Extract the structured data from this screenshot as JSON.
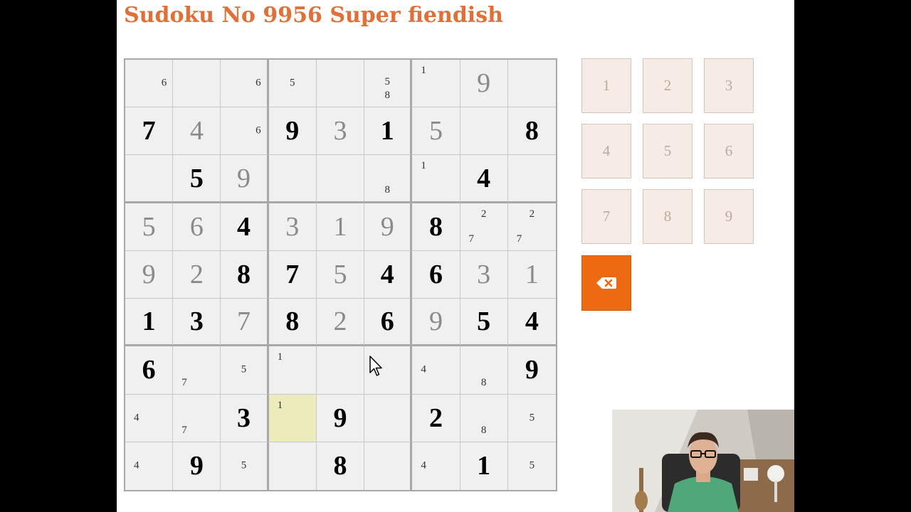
{
  "title": "Sudoku No 9956 Super fiendish",
  "board": [
    [
      {
        "pm": [
          {
            "t": "6",
            "pos": "mid right"
          }
        ]
      },
      {},
      {
        "pm": [
          {
            "t": "6",
            "pos": "mid right"
          }
        ]
      },
      {
        "pm": [
          {
            "t": "5",
            "pos": "mid center"
          }
        ]
      },
      {},
      {
        "pm": [
          {
            "t": "5",
            "pos": "top2 center"
          },
          {
            "t": "8",
            "pos": "bot center"
          }
        ]
      },
      {
        "pm": [
          {
            "t": "1",
            "pos": "top left"
          }
        ]
      },
      {
        "v": "9",
        "k": "user"
      },
      {}
    ],
    [
      {
        "v": "7",
        "k": "given"
      },
      {
        "v": "4",
        "k": "user"
      },
      {
        "pm": [
          {
            "t": "6",
            "pos": "mid right"
          }
        ]
      },
      {
        "v": "9",
        "k": "given"
      },
      {
        "v": "3",
        "k": "user"
      },
      {
        "v": "1",
        "k": "given"
      },
      {
        "v": "5",
        "k": "user"
      },
      {},
      {
        "v": "8",
        "k": "given"
      }
    ],
    [
      {},
      {
        "v": "5",
        "k": "given"
      },
      {
        "v": "9",
        "k": "user"
      },
      {},
      {},
      {
        "pm": [
          {
            "t": "8",
            "pos": "bot center"
          }
        ]
      },
      {
        "pm": [
          {
            "t": "1",
            "pos": "top left"
          }
        ]
      },
      {
        "v": "4",
        "k": "given"
      },
      {}
    ],
    [
      {
        "v": "5",
        "k": "user"
      },
      {
        "v": "6",
        "k": "user"
      },
      {
        "v": "4",
        "k": "given"
      },
      {
        "v": "3",
        "k": "user"
      },
      {
        "v": "1",
        "k": "user"
      },
      {
        "v": "9",
        "k": "user"
      },
      {
        "v": "8",
        "k": "given"
      },
      {
        "pm": [
          {
            "t": "2",
            "pos": "top center"
          },
          {
            "t": "7",
            "pos": "bot left"
          }
        ]
      },
      {
        "pm": [
          {
            "t": "2",
            "pos": "top center"
          },
          {
            "t": "7",
            "pos": "bot left"
          }
        ]
      }
    ],
    [
      {
        "v": "9",
        "k": "user"
      },
      {
        "v": "2",
        "k": "user"
      },
      {
        "v": "8",
        "k": "given"
      },
      {
        "v": "7",
        "k": "given"
      },
      {
        "v": "5",
        "k": "user"
      },
      {
        "v": "4",
        "k": "given"
      },
      {
        "v": "6",
        "k": "given"
      },
      {
        "v": "3",
        "k": "user"
      },
      {
        "v": "1",
        "k": "user"
      }
    ],
    [
      {
        "v": "1",
        "k": "given"
      },
      {
        "v": "3",
        "k": "given"
      },
      {
        "v": "7",
        "k": "user"
      },
      {
        "v": "8",
        "k": "given"
      },
      {
        "v": "2",
        "k": "user"
      },
      {
        "v": "6",
        "k": "given"
      },
      {
        "v": "9",
        "k": "user"
      },
      {
        "v": "5",
        "k": "given"
      },
      {
        "v": "4",
        "k": "given"
      }
    ],
    [
      {
        "v": "6",
        "k": "given"
      },
      {
        "pm": [
          {
            "t": "7",
            "pos": "bot left"
          }
        ]
      },
      {
        "pm": [
          {
            "t": "5",
            "pos": "mid center"
          }
        ]
      },
      {
        "pm": [
          {
            "t": "1",
            "pos": "top left"
          }
        ]
      },
      {},
      {},
      {
        "pm": [
          {
            "t": "4",
            "pos": "mid left"
          }
        ]
      },
      {
        "pm": [
          {
            "t": "8",
            "pos": "bot center"
          }
        ]
      },
      {
        "v": "9",
        "k": "given"
      }
    ],
    [
      {
        "pm": [
          {
            "t": "4",
            "pos": "mid left"
          }
        ]
      },
      {
        "pm": [
          {
            "t": "7",
            "pos": "bot left"
          }
        ]
      },
      {
        "v": "3",
        "k": "given"
      },
      {
        "pm": [
          {
            "t": "1",
            "pos": "top left"
          }
        ],
        "sel": true
      },
      {
        "v": "9",
        "k": "given"
      },
      {},
      {
        "v": "2",
        "k": "given"
      },
      {
        "pm": [
          {
            "t": "8",
            "pos": "bot center"
          }
        ]
      },
      {
        "pm": [
          {
            "t": "5",
            "pos": "mid center"
          }
        ]
      }
    ],
    [
      {
        "pm": [
          {
            "t": "4",
            "pos": "mid left"
          }
        ]
      },
      {
        "v": "9",
        "k": "given"
      },
      {
        "pm": [
          {
            "t": "5",
            "pos": "mid center"
          }
        ]
      },
      {},
      {
        "v": "8",
        "k": "given"
      },
      {},
      {
        "pm": [
          {
            "t": "4",
            "pos": "mid left"
          }
        ]
      },
      {
        "v": "1",
        "k": "given"
      },
      {
        "pm": [
          {
            "t": "5",
            "pos": "mid center"
          }
        ]
      }
    ]
  ],
  "keypad": [
    "1",
    "2",
    "3",
    "4",
    "5",
    "6",
    "7",
    "8",
    "9"
  ],
  "delete_icon": "backspace-icon",
  "colors": {
    "title": "#e0703a",
    "selected_cell": "#ecebbc",
    "key_bg": "#f7ebe5",
    "delete_bg": "#ee6a12"
  }
}
